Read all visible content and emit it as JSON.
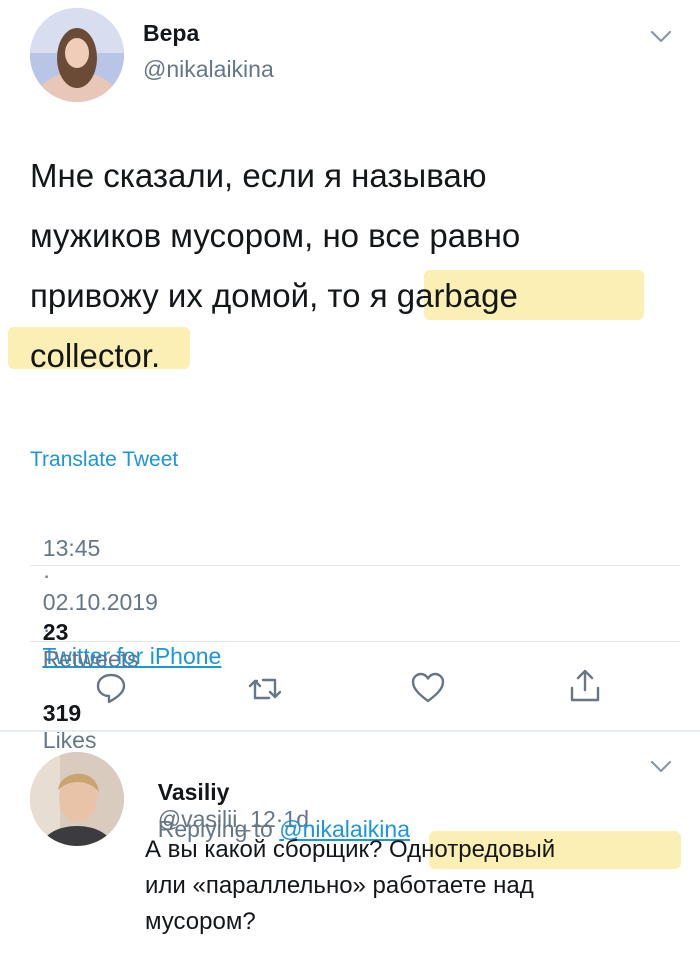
{
  "tweet": {
    "author": {
      "display_name": "Вера",
      "handle": "@nikalaikina"
    },
    "text_lines": [
      "Мне сказали, если я называю",
      "мужиков мусором, но все равно",
      "привожу их домой, то ",
      "я garbage",
      "collector."
    ],
    "translate_label": "Translate Tweet",
    "time": "13:45",
    "date": "02.10.2019",
    "separator": "·",
    "source": "Twitter for iPhone",
    "retweets_count": "23",
    "retweets_label": "Retweets",
    "likes_count": "319",
    "likes_label": "Likes",
    "actions": [
      "reply-icon",
      "retweet-icon",
      "like-icon",
      "share-icon"
    ]
  },
  "reply": {
    "author": {
      "display_name": "Vasiliy",
      "handle": "@vasilii_12",
      "age": "1d"
    },
    "replying_prefix": "Replying to ",
    "replying_handle": "@nikalaikina",
    "text_line1_a": "А вы какой сборщик? ",
    "text_line1_b": "Однотредовый",
    "text_line2": "или «параллельно» работаете над",
    "text_line3": "мусором?"
  },
  "colors": {
    "accent": "#1b95e0",
    "highlight": "#fbeeb0",
    "secondary_text": "#657786"
  }
}
